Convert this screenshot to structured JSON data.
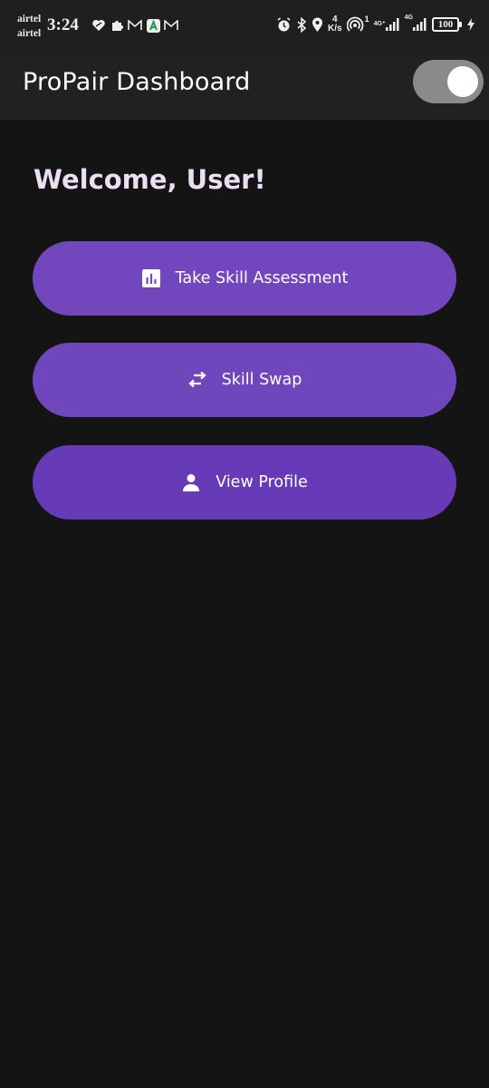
{
  "status_bar": {
    "carrier_1": "airtel",
    "carrier_2": "airtel",
    "time": "3:24",
    "net_speed_value": "4",
    "net_speed_unit": "K/s",
    "hotspot_count": "1",
    "sim1_tech": "4G⁺",
    "sim2_tech": "4G",
    "battery": "100",
    "icons": [
      "vpn-heart-icon",
      "puzzle-icon",
      "gmail-icon",
      "app-a-icon",
      "gmail-icon",
      "alarm-icon",
      "bluetooth-icon",
      "location-icon",
      "hotspot-icon",
      "signal-icon",
      "signal-icon",
      "battery-icon",
      "charging-icon"
    ]
  },
  "app_bar": {
    "title": "ProPair Dashboard",
    "theme_toggle_on": true
  },
  "main": {
    "welcome": "Welcome, User!",
    "buttons": [
      {
        "label": "Take Skill Assessment",
        "icon": "bar-chart-icon"
      },
      {
        "label": "Skill Swap",
        "icon": "swap-arrows-icon"
      },
      {
        "label": "View Profile",
        "icon": "person-icon"
      }
    ]
  },
  "colors": {
    "background": "#141414",
    "app_bar": "#212121",
    "button": "#673ab7",
    "welcome_text": "#ecdff3"
  }
}
